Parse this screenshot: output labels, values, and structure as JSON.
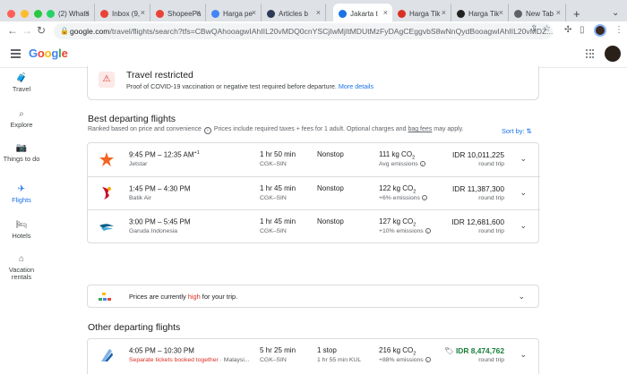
{
  "browser": {
    "tabs": [
      {
        "label": "(2) Whats",
        "icon": "whatsapp-icon",
        "color": "#25d366"
      },
      {
        "label": "Inbox (9,",
        "icon": "gmail-icon",
        "color": "#ea4335"
      },
      {
        "label": "ShopeePa",
        "icon": "gmail-icon",
        "color": "#ea4335"
      },
      {
        "label": "Harga pe",
        "icon": "google-icon",
        "color": "#4285f4"
      },
      {
        "label": "Articles b",
        "icon": "site-icon",
        "color": "#2b3a55"
      },
      {
        "label": "Jakarta t",
        "icon": "flights-icon",
        "color": "#1a73e8",
        "active": true
      },
      {
        "label": "Harga Tik",
        "icon": "airline-icon",
        "color": "#d93025"
      },
      {
        "label": "Harga Tik",
        "icon": "site-icon",
        "color": "#222222"
      },
      {
        "label": "New Tab",
        "icon": "chrome-icon",
        "color": "#5f6368"
      }
    ],
    "url_host": "google.com",
    "url_path": "/travel/flights/search?tfs=CBwQAhooagwIAhIIL20vMDQ0cnYSCjIwMjItMDUtMzFyDAgCEggvbS8wNnQydBooagwIAhIIL20vMDZ..."
  },
  "app": {
    "logo_text": "Google",
    "logo_colors": [
      "#4285f4",
      "#ea4335",
      "#fbbc05",
      "#4285f4",
      "#34a853",
      "#ea4335"
    ]
  },
  "sidebar": {
    "items": [
      {
        "label": "Travel",
        "icon": "luggage-icon",
        "glyph": "🧳"
      },
      {
        "label": "Explore",
        "icon": "explore-icon",
        "glyph": "⌕"
      },
      {
        "label": "Things to do",
        "icon": "camera-icon",
        "glyph": "📷"
      },
      {
        "label": "Flights",
        "icon": "flight-icon",
        "glyph": "✈",
        "active": true
      },
      {
        "label": "Hotels",
        "icon": "bed-icon",
        "glyph": "🛏"
      },
      {
        "label": "Vacation rentals",
        "icon": "house-icon",
        "glyph": "⌂"
      }
    ]
  },
  "restriction": {
    "title": "Travel restricted",
    "text": "Proof of COVID-19 vaccination or negative test required before departure.",
    "link": "More details"
  },
  "best": {
    "heading": "Best departing flights",
    "sub1": "Ranked based on price and convenience",
    "sub2": "Prices include required taxes + fees for 1 adult. Optional charges and",
    "sub_link": "bag fees",
    "sub3": "may apply.",
    "sort_label": "Sort by:",
    "flights": [
      {
        "times": "9:45 PM – 12:35 AM",
        "plus": "+1",
        "airline": "Jetstar",
        "duration": "1 hr 50 min",
        "route": "CGK–SIN",
        "stops": "Nonstop",
        "stop_detail": "",
        "co2": "111 kg CO",
        "emissions": "Avg emissions",
        "price": "IDR 10,011,225",
        "trip": "round trip",
        "logo": "jetstar"
      },
      {
        "times": "1:45 PM – 4:30 PM",
        "plus": "",
        "airline": "Batik Air",
        "duration": "1 hr 45 min",
        "route": "CGK–SIN",
        "stops": "Nonstop",
        "stop_detail": "",
        "co2": "122 kg CO",
        "emissions": "+6% emissions",
        "price": "IDR 11,387,300",
        "trip": "round trip",
        "logo": "batik"
      },
      {
        "times": "3:00 PM – 5:45 PM",
        "plus": "",
        "airline": "Garuda Indonesia",
        "duration": "1 hr 45 min",
        "route": "CGK–SIN",
        "stops": "Nonstop",
        "stop_detail": "",
        "co2": "127 kg CO",
        "emissions": "+10% emissions",
        "price": "IDR 12,681,600",
        "trip": "round trip",
        "logo": "garuda"
      }
    ]
  },
  "insight": {
    "pre": "Prices are currently",
    "level": "high",
    "post": "for your trip."
  },
  "other": {
    "heading": "Other departing flights",
    "flights": [
      {
        "times": "4:05 PM – 10:30 PM",
        "airline_warn": "Separate tickets booked together",
        "airline": " · Malaysi...",
        "duration": "5 hr 25 min",
        "route": "CGK–SIN",
        "stops": "1 stop",
        "stop_detail": "1 hr 55 min KUL",
        "co2": "216 kg CO",
        "emissions": "+88% emissions",
        "price": "IDR 8,474,762",
        "trip": "round trip",
        "logo": "malaysia"
      }
    ]
  }
}
